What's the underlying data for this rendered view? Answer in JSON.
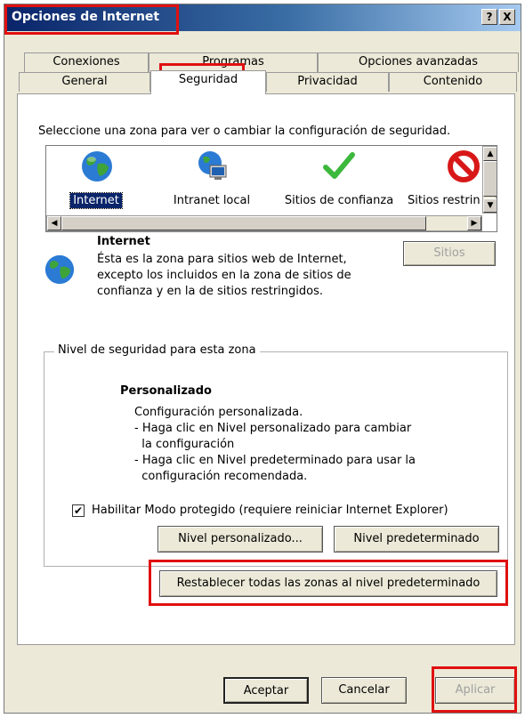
{
  "window": {
    "title": "Opciones de Internet",
    "help_glyph": "?",
    "close_glyph": "X"
  },
  "tabs": {
    "row1": [
      "Conexiones",
      "Programas",
      "Opciones avanzadas"
    ],
    "row2": [
      "General",
      "Seguridad",
      "Privacidad",
      "Contenido"
    ],
    "active": "Seguridad"
  },
  "security": {
    "instruction": "Seleccione una zona para ver o cambiar la configuración de seguridad.",
    "zones": [
      {
        "label": "Internet",
        "icon": "globe-icon",
        "selected": true
      },
      {
        "label": "Intranet local",
        "icon": "globe-monitor-icon"
      },
      {
        "label": "Sitios de confianza",
        "icon": "checkmark-icon"
      },
      {
        "label": "Sitios restrin",
        "icon": "no-entry-icon"
      }
    ],
    "zone_info": {
      "name": "Internet",
      "desc_lines": [
        "Ésta es la zona para sitios web de Internet,",
        "excepto los incluidos en la zona de sitios de",
        "confianza y en la de sitios restringidos."
      ]
    },
    "sites_button": "Sitios"
  },
  "level": {
    "group_label": "Nivel de seguridad para esta zona",
    "heading": "Personalizado",
    "lines": [
      "Configuración personalizada.",
      "- Haga clic en Nivel personalizado para cambiar",
      "  la configuración",
      "- Haga clic en Nivel predeterminado para usar la",
      "  configuración recomendada."
    ],
    "protected_mode_label": "Habilitar Modo protegido (requiere reiniciar Internet Explorer)",
    "protected_mode_checked": true,
    "custom_level_button": "Nivel personalizado...",
    "default_level_button": "Nivel predeterminado",
    "reset_all_button": "Restablecer todas las zonas al nivel predeterminado"
  },
  "footer": {
    "ok": "Aceptar",
    "cancel": "Cancelar",
    "apply": "Aplicar"
  },
  "colors": {
    "highlight": "#e01010",
    "titlebar": "#0a246a",
    "selection": "#0a246a"
  }
}
